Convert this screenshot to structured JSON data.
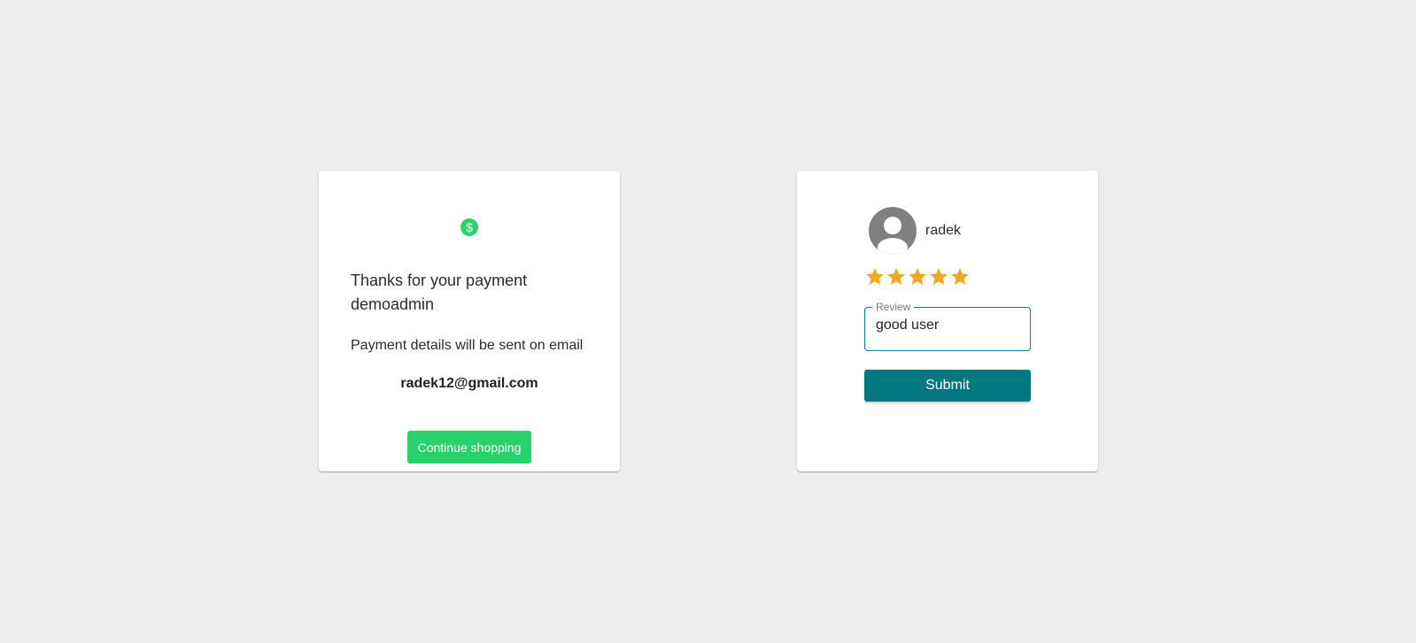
{
  "payment_card": {
    "icon": "dollar-circle-icon",
    "thanks_line1": "Thanks for your payment",
    "thanks_line2": "demoadmin",
    "details_note": "Payment details will be sent on email",
    "email": "radek12@gmail.com",
    "continue_label": "Continue shopping"
  },
  "review_card": {
    "avatar_icon": "user-avatar-icon",
    "username": "radek",
    "rating": 5,
    "rating_max": 5,
    "review_label": "Review",
    "review_value": "good user",
    "submit_label": "Submit"
  },
  "colors": {
    "background": "#eeeeee",
    "card": "#ffffff",
    "success_green": "#28d26a",
    "teal": "#007882",
    "star": "#f5a623",
    "avatar_gray": "#808080"
  }
}
